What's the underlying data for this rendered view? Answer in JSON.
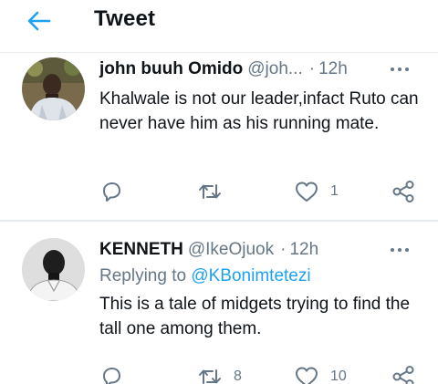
{
  "header": {
    "title": "Tweet"
  },
  "tweets": [
    {
      "author": "john buuh Omido",
      "handle": "@joh...",
      "separator": "·",
      "time": "12h",
      "replying_label": "",
      "replying_to": "",
      "text": "Khalwale is not our leader,infact Ruto can never have him as his running mate.",
      "reply_count": "",
      "retweet_count": "",
      "like_count": "1"
    },
    {
      "author": "KENNETH",
      "handle": "@IkeOjuok",
      "separator": "·",
      "time": "12h",
      "replying_label": "Replying to",
      "replying_to": "@KBonimtetezi",
      "text": "This is a tale of midgets trying to find the tall one among them.",
      "reply_count": "",
      "retweet_count": "8",
      "like_count": "10"
    }
  ],
  "colors": {
    "accent": "#1da1f2",
    "muted": "#657786",
    "text": "#0f1419",
    "divider": "#e6ecf0"
  },
  "icons": {
    "back": "arrow-left-icon",
    "more": "more-horizontal-icon",
    "reply": "reply-icon",
    "retweet": "retweet-icon",
    "like": "heart-icon",
    "share": "share-icon"
  }
}
